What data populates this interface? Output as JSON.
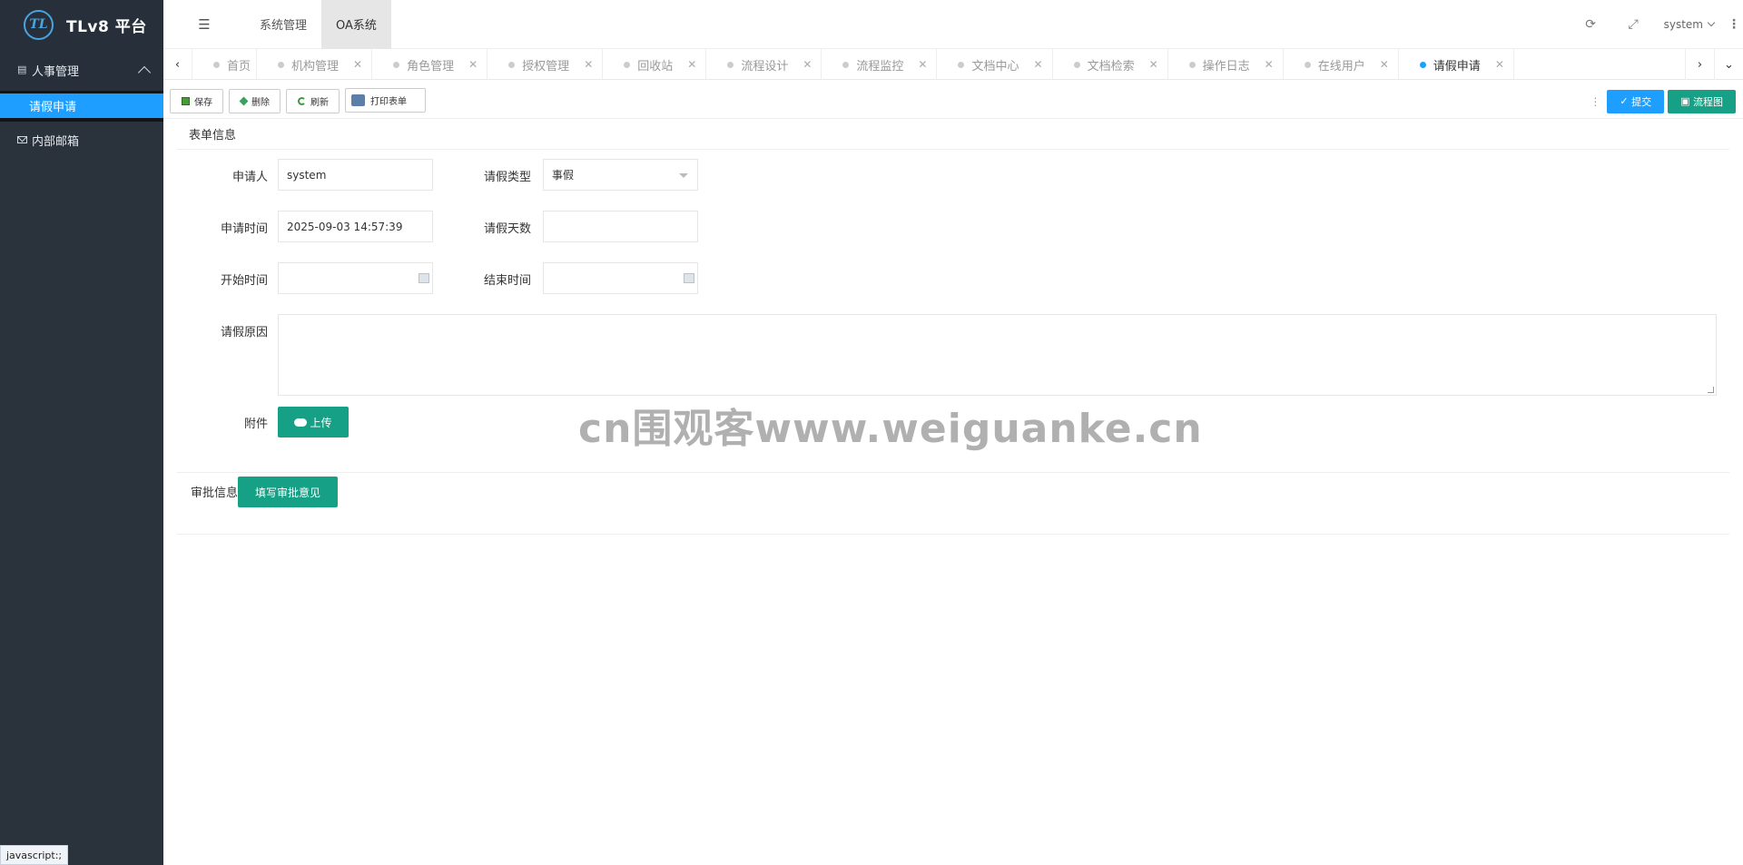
{
  "app": {
    "logo_mark": "TL",
    "title": "TLv8 平台"
  },
  "sidebar": {
    "group_label": "人事管理",
    "items": [
      {
        "label": "请假申请",
        "active": true
      },
      {
        "label": "内部邮箱",
        "active": false
      }
    ]
  },
  "header": {
    "menu_icon": "☰",
    "tabs": [
      {
        "label": "系统管理",
        "active": false
      },
      {
        "label": "OA系统",
        "active": true
      }
    ],
    "username": "system"
  },
  "page_tabs": [
    {
      "label": "首页",
      "closable": false,
      "active": false
    },
    {
      "label": "机构管理",
      "closable": true,
      "active": false
    },
    {
      "label": "角色管理",
      "closable": true,
      "active": false
    },
    {
      "label": "授权管理",
      "closable": true,
      "active": false
    },
    {
      "label": "回收站",
      "closable": true,
      "active": false
    },
    {
      "label": "流程设计",
      "closable": true,
      "active": false
    },
    {
      "label": "流程监控",
      "closable": true,
      "active": false
    },
    {
      "label": "文档中心",
      "closable": true,
      "active": false
    },
    {
      "label": "文档检索",
      "closable": true,
      "active": false
    },
    {
      "label": "操作日志",
      "closable": true,
      "active": false
    },
    {
      "label": "在线用户",
      "closable": true,
      "active": false
    },
    {
      "label": "请假申请",
      "closable": true,
      "active": true
    }
  ],
  "toolbar": {
    "save_label": "保存",
    "delete_label": "删除",
    "refresh_label": "刷新",
    "print_label": "打印表单",
    "submit_label": "提交",
    "flowchart_label": "流程图"
  },
  "form": {
    "section_title": "表单信息",
    "applicant_label": "申请人",
    "applicant_value": "system",
    "leave_type_label": "请假类型",
    "leave_type_value": "事假",
    "apply_time_label": "申请时间",
    "apply_time_value": "2025-09-03 14:57:39",
    "leave_days_label": "请假天数",
    "leave_days_value": "",
    "start_time_label": "开始时间",
    "start_time_value": "",
    "end_time_label": "结束时间",
    "end_time_value": "",
    "reason_label": "请假原因",
    "reason_value": "",
    "attachment_label": "附件",
    "upload_label": "上传"
  },
  "approval": {
    "section_title": "审批信息",
    "write_opinion_label": "填写审批意见"
  },
  "watermark": "cn围观客www.weiguanke.cn",
  "status_bar": "javascript:;",
  "colors": {
    "accent_blue": "#1e9fff",
    "teal": "#16a085",
    "sidebar_bg": "#2a323c"
  }
}
